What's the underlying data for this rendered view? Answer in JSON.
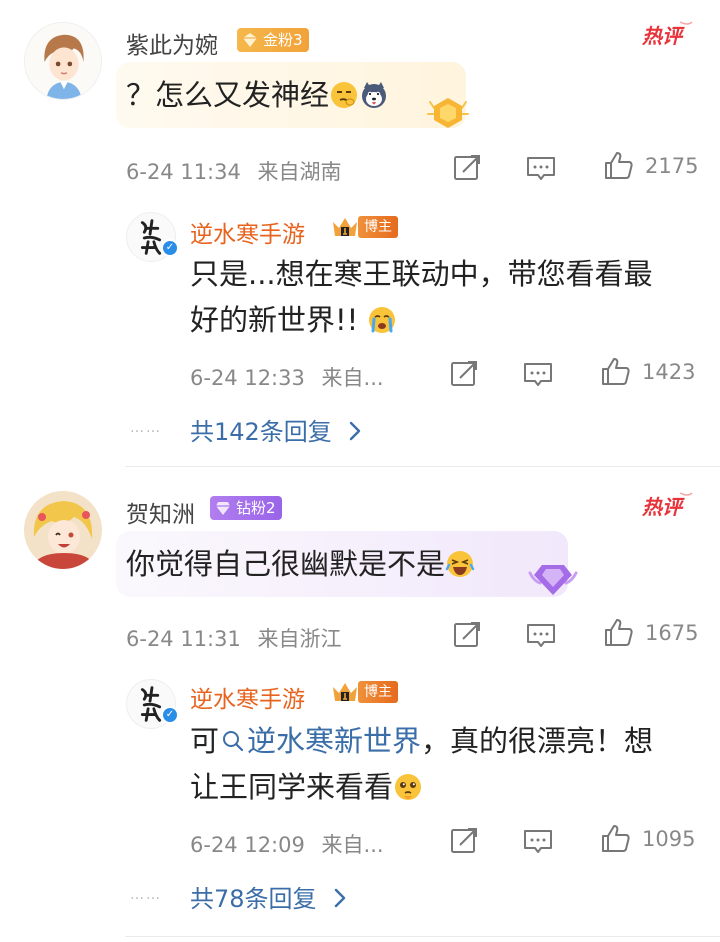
{
  "comments": [
    {
      "username": "紫此为婉",
      "fan_badge": "金粉3",
      "hot_tag": "热评",
      "text_prefix": "？怎么又发神经",
      "time": "6-24 11:34",
      "location": "来自湖南",
      "like_count": "2175",
      "reply": {
        "username": "逆水寒手游",
        "role_badge": "博主",
        "line1": "只是...想在寒王联动中，带您看看最",
        "line2": "好的新世界!!",
        "time": "6-24 12:33",
        "location": "来自...",
        "like_count": "1423"
      },
      "more_replies": "共142条回复",
      "dots": "……"
    },
    {
      "username": "贺知洲",
      "fan_badge": "钻粉2",
      "hot_tag": "热评",
      "text_prefix": "你觉得自己很幽默是不是",
      "time": "6-24 11:31",
      "location": "来自浙江",
      "like_count": "1675",
      "reply": {
        "username": "逆水寒手游",
        "role_badge": "博主",
        "line1_prefix": "可",
        "line1_link": "逆水寒新世界",
        "line1_suffix": "，真的很漂亮！想",
        "line2": "让王同学来看看",
        "time": "6-24 12:09",
        "location": "来自...",
        "like_count": "1095"
      },
      "more_replies": "共78条回复",
      "dots": "……"
    }
  ],
  "icons": {
    "share": "share-icon",
    "comment": "comment-icon",
    "like": "thumbs-up-icon",
    "chevron": "chevron-right-icon",
    "search": "search-icon"
  },
  "colors": {
    "brand_orange": "#e8631e",
    "link_blue": "#3b6ea8",
    "gold_badge": "#f5b84a",
    "diamond_badge": "#b17ef0",
    "hot_red": "#e8333a"
  }
}
